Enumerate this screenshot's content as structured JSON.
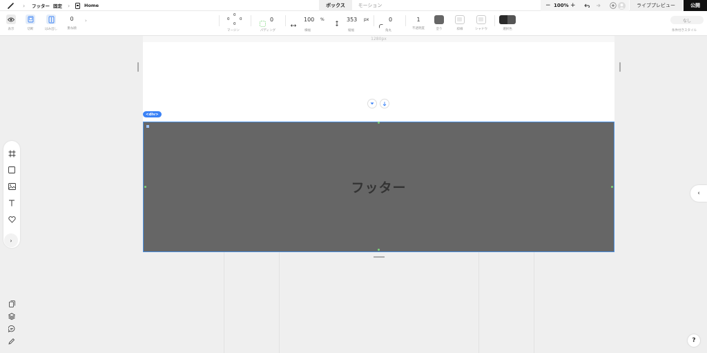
{
  "topbar": {
    "breadcrumb": [
      "フッター",
      "固定",
      "Home"
    ],
    "tabs": [
      "ボックス",
      "モーション"
    ],
    "zoom": "100%",
    "zoom_out": "−",
    "zoom_in": "+",
    "preview_label": "ライブプレビュー",
    "publish_label": "公開"
  },
  "toolbar": {
    "display_label": "表示",
    "clip_label": "切断",
    "overflow_label": "はみ出し",
    "overlap_value": "0",
    "overlap_label": "重ね順",
    "margin_label": "マージン",
    "margin_values": [
      "0",
      "0",
      "0",
      "0"
    ],
    "padding_value": "0",
    "padding_label": "パディング",
    "width_value": "100",
    "width_unit": "%",
    "width_label": "横幅",
    "height_value": "353",
    "height_unit": "px",
    "height_label": "縦幅",
    "radius_value": "0",
    "radius_label": "角丸",
    "opacity_value": "1",
    "opacity_label": "不透明度",
    "fill_label": "塗り",
    "border_label": "枠線",
    "shadow_label": "シャドウ",
    "select_color_label": "選択色",
    "conditional_style_value": "なし",
    "conditional_style_label": "条件付きスタイル",
    "fill_color": "#666666",
    "select_color": "#2a2a2a"
  },
  "canvas": {
    "width_label": "1280px",
    "element_tag": "<div>",
    "footer_text": "フッター",
    "footer_color": "#666666",
    "selection_color": "#4a90e2"
  },
  "help": "?"
}
